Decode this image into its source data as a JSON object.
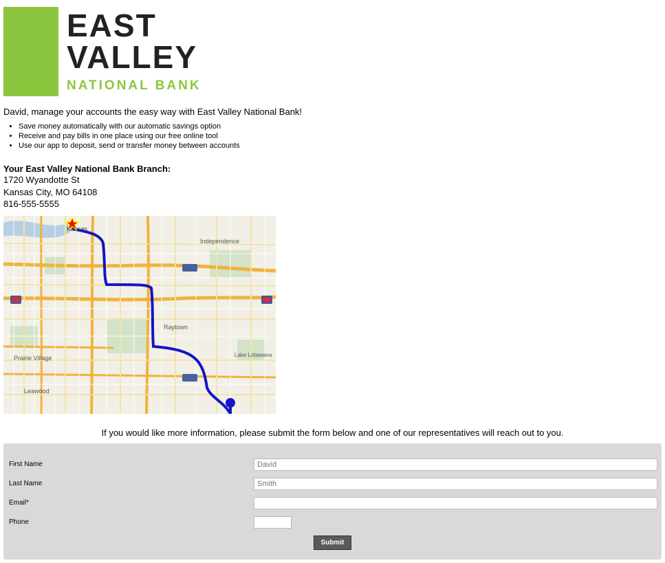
{
  "logo": {
    "line1": "EAST",
    "line2": "VALLEY",
    "sub": "NATIONAL BANK"
  },
  "intro": "David, manage your accounts the easy way with East Valley National Bank!",
  "features": [
    "Save money automatically with our automatic savings option",
    "Receive and pay bills in one place using our free online tool",
    "Use our app to deposit, send or transfer money between accounts"
  ],
  "branch": {
    "title": "Your East Valley National Bank Branch:",
    "addr1": "1720 Wyandotte St",
    "addr2": "Kansas City, MO 64108",
    "phone": "816-555-5555"
  },
  "map": {
    "labels": {
      "kansas": "Kansas",
      "independence": "Independence",
      "raytown": "Raytown",
      "prairie": "Prairie Village",
      "leawood": "Leawood",
      "lakelot": "Lake Lotawana"
    }
  },
  "form": {
    "intro": "If you would like more information, please submit the form below and one of our representatives will reach out to you.",
    "labels": {
      "first": "First Name",
      "last": "Last Name",
      "email": "Email*",
      "phone": "Phone"
    },
    "placeholders": {
      "first": "David",
      "last": "Smith"
    },
    "submit": "Submit"
  }
}
